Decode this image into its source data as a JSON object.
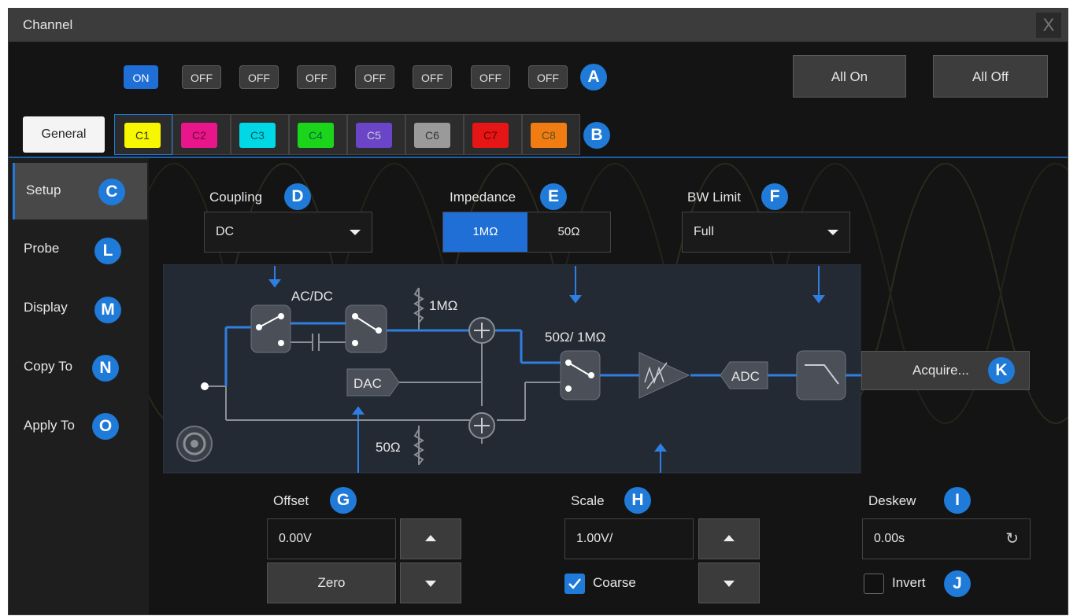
{
  "window": {
    "title": "Channel",
    "close_glyph": "X"
  },
  "switches": [
    "ON",
    "OFF",
    "OFF",
    "OFF",
    "OFF",
    "OFF",
    "OFF",
    "OFF"
  ],
  "header_buttons": {
    "all_on": "All On",
    "all_off": "All Off"
  },
  "tabs": {
    "general": "General",
    "channels": [
      {
        "label": "C1",
        "color": "#f7f700"
      },
      {
        "label": "C2",
        "color": "#e8168a"
      },
      {
        "label": "C3",
        "color": "#00d8e6"
      },
      {
        "label": "C4",
        "color": "#1bd51b"
      },
      {
        "label": "C5",
        "color": "#6b45c7"
      },
      {
        "label": "C6",
        "color": "#9a9a9a"
      },
      {
        "label": "C7",
        "color": "#e61616"
      },
      {
        "label": "C8",
        "color": "#f07c12"
      }
    ]
  },
  "sidebar": {
    "items": [
      "Setup",
      "Probe",
      "Display",
      "Copy To",
      "Apply To"
    ]
  },
  "coupling": {
    "label": "Coupling",
    "value": "DC"
  },
  "impedance": {
    "label": "Impedance",
    "options": [
      "1MΩ",
      "50Ω"
    ],
    "selected": "1MΩ"
  },
  "bw_limit": {
    "label": "BW Limit",
    "value": "Full"
  },
  "diagram": {
    "acdc": "AC/DC",
    "r1": "1MΩ",
    "dac": "DAC",
    "r50": "50Ω",
    "switch_label": "50Ω/ 1MΩ",
    "adc": "ADC",
    "acquire": "Acquire..."
  },
  "offset": {
    "label": "Offset",
    "value": "0.00V",
    "zero": "Zero"
  },
  "scale": {
    "label": "Scale",
    "value": "1.00V/",
    "coarse": "Coarse",
    "coarse_checked": true
  },
  "deskew": {
    "label": "Deskew",
    "value": "0.00s",
    "refresh_glyph": "↻"
  },
  "invert": {
    "label": "Invert",
    "checked": false
  },
  "badges": {
    "A": "A",
    "B": "B",
    "C": "C",
    "D": "D",
    "E": "E",
    "F": "F",
    "G": "G",
    "H": "H",
    "I": "I",
    "J": "J",
    "K": "K",
    "L": "L",
    "M": "M",
    "N": "N",
    "O": "O"
  },
  "colors": {
    "accent": "#1f7ad8",
    "on": "#1f6fd6"
  }
}
